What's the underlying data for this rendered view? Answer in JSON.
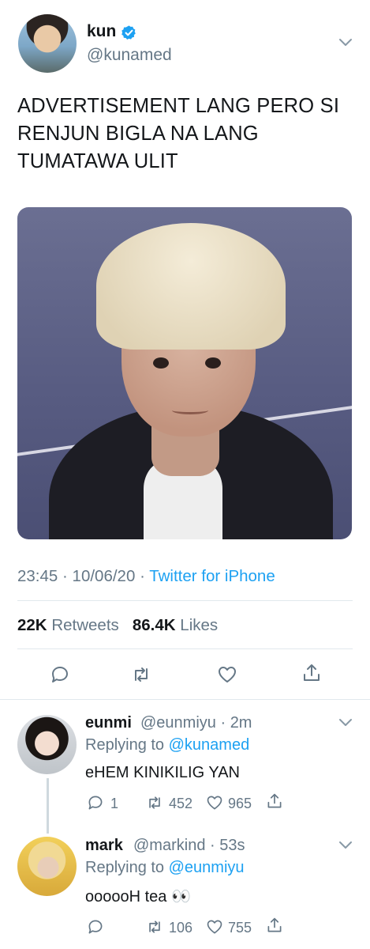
{
  "tweet": {
    "name": "kun",
    "handle": "@kunamed",
    "text": "ADVERTISEMENT LANG PERO SI RENJUN BIGLA NA LANG TUMATAWA ULIT",
    "time": "23:45",
    "date": "10/06/20",
    "source": "Twitter for iPhone",
    "retweets": "22K",
    "retweets_label": "Retweets",
    "likes": "86.4K",
    "likes_label": "Likes"
  },
  "replies": [
    {
      "name": "eunmi",
      "handle": "@eunmiyu",
      "time": "2m",
      "replying_label": "Replying to",
      "replying_to": "@kunamed",
      "text": "eHEM KINIKILIG YAN",
      "reply_count": "1",
      "retweet_count": "452",
      "like_count": "965"
    },
    {
      "name": "mark",
      "handle": "@markind",
      "time": "53s",
      "replying_label": "Replying to",
      "replying_to": "@eunmiyu",
      "text": "oooooH tea 👀",
      "reply_count": "",
      "retweet_count": "106",
      "like_count": "755"
    }
  ],
  "colors": {
    "accent": "#1da1f2",
    "muted": "#657786",
    "text": "#14171a",
    "divider": "#e1e8ed"
  },
  "icons": [
    "verified-badge-icon",
    "chevron-down-icon",
    "reply-icon",
    "retweet-icon",
    "like-icon",
    "share-icon"
  ]
}
